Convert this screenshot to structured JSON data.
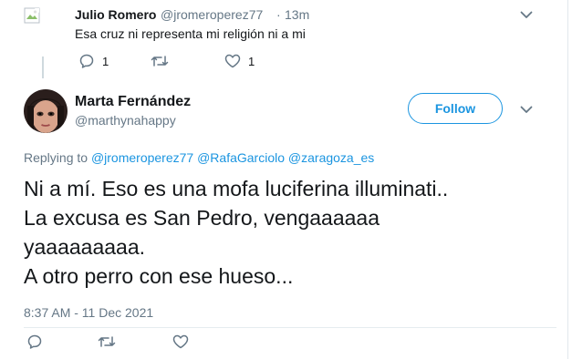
{
  "colors": {
    "accent": "#1b95e0",
    "muted": "#657786",
    "text": "#14171a"
  },
  "parent_tweet": {
    "author_name": "Julio Romero",
    "handle": "@jromeroperez77",
    "separator": "·",
    "time": "13m",
    "text": "Esa cruz ni representa mi religión ni a mi",
    "reply_count": "1",
    "like_count": "1",
    "avatar_icon": "broken-image-icon"
  },
  "main_tweet": {
    "author_name": "Marta Fernández",
    "handle": "@marthynahappy",
    "follow_label": "Follow",
    "replying_prefix": "Replying to",
    "replying_to": [
      "@jromeroperez77",
      "@RafaGarciolo",
      "@zaragoza_es"
    ],
    "text": "Ni a mí. Eso es una mofa luciferina illuminati..\nLa excusa es San Pedro, vengaaaaaa\nyaaaaaaaaa.\nA otro perro con ese hueso...",
    "timestamp": "8:37 AM - 11 Dec 2021"
  },
  "icons": [
    "reply-icon",
    "retweet-icon",
    "like-icon",
    "chevron-down-icon"
  ]
}
